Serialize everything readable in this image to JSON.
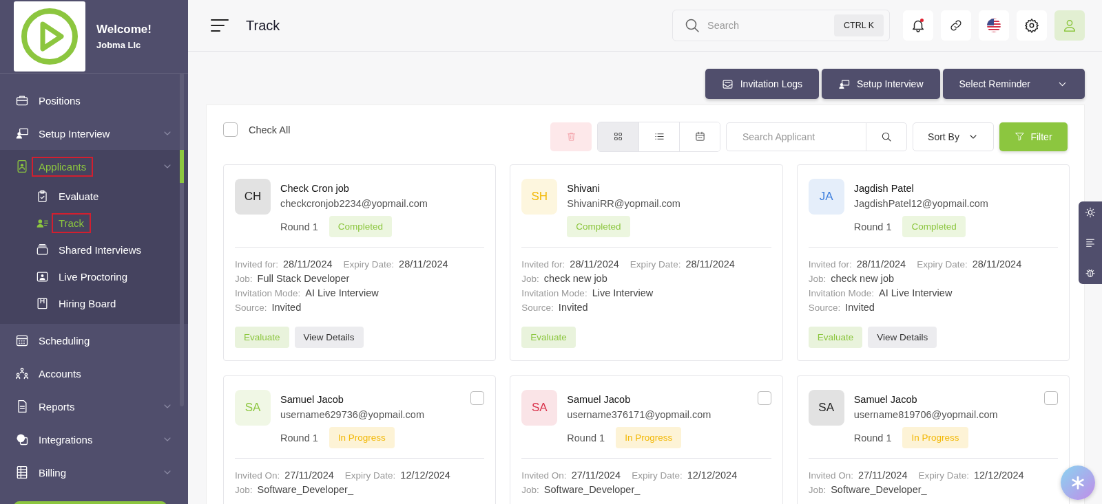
{
  "sidebar": {
    "greeting": "Welcome!",
    "company": "Jobma Llc",
    "items": [
      {
        "label": "Positions",
        "expandable": false,
        "expanded": false,
        "selected": false,
        "outlined": false
      },
      {
        "label": "Setup Interview",
        "expandable": true,
        "expanded": false,
        "selected": false,
        "outlined": false
      },
      {
        "label": "Applicants",
        "expandable": true,
        "expanded": true,
        "selected": true,
        "outlined": true,
        "children": [
          {
            "label": "Evaluate",
            "selected": false,
            "outlined": false
          },
          {
            "label": "Track",
            "selected": true,
            "outlined": true
          },
          {
            "label": "Shared Interviews",
            "selected": false,
            "outlined": false
          },
          {
            "label": "Live Proctoring",
            "selected": false,
            "outlined": false
          },
          {
            "label": "Hiring Board",
            "selected": false,
            "outlined": false
          }
        ]
      },
      {
        "label": "Scheduling",
        "expandable": false,
        "expanded": false,
        "selected": false,
        "outlined": false
      },
      {
        "label": "Accounts",
        "expandable": false,
        "expanded": false,
        "selected": false,
        "outlined": false
      },
      {
        "label": "Reports",
        "expandable": true,
        "expanded": false,
        "selected": false,
        "outlined": false
      },
      {
        "label": "Integrations",
        "expandable": true,
        "expanded": false,
        "selected": false,
        "outlined": false
      },
      {
        "label": "Billing",
        "expandable": true,
        "expanded": false,
        "selected": false,
        "outlined": false
      }
    ]
  },
  "header": {
    "title": "Track",
    "search": {
      "placeholder": "Search",
      "shortcut": "CTRL K"
    },
    "unread_notifications": true
  },
  "actions": [
    {
      "label": "Invitation Logs",
      "kind": "logs"
    },
    {
      "label": "Setup Interview",
      "kind": "setup"
    },
    {
      "label": "Select Reminder",
      "kind": "dropdown"
    }
  ],
  "toolbar": {
    "check_all": {
      "label": "Check All",
      "checked": false
    },
    "views": [
      {
        "selected": true
      },
      {
        "selected": false
      },
      {
        "selected": false
      }
    ],
    "search": {
      "placeholder": "Search Applicant"
    },
    "sort": {
      "label": "Sort By"
    },
    "filter": {
      "label": "Filter"
    }
  },
  "cards": [
    {
      "initials": "CH",
      "color": "#222222",
      "name": "Check Cron job",
      "email": "checkcronjob2234@yopmail.com",
      "round": "Round 1",
      "status": {
        "label": "Completed",
        "color": "#8cc63f"
      },
      "details": [
        [
          {
            "label": "Invited for:",
            "value": "28/11/2024"
          },
          {
            "label": "Expiry Date:",
            "value": "28/11/2024"
          }
        ],
        [
          {
            "label": "Job:",
            "value": "Full Stack Developer"
          }
        ],
        [
          {
            "label": "Invitation Mode:",
            "value": "AI Live Interview"
          }
        ],
        [
          {
            "label": "Source:",
            "value": "Invited"
          }
        ]
      ],
      "buttons": [
        {
          "label": "Evaluate",
          "kind": "evaluate"
        },
        {
          "label": "View Details",
          "kind": "details"
        }
      ]
    },
    {
      "initials": "SH",
      "color": "#f2b807",
      "name": "Shivani",
      "email": "ShivaniRR@yopmail.com",
      "status": {
        "label": "Completed",
        "color": "#8cc63f"
      },
      "details": [
        [
          {
            "label": "Invited for:",
            "value": "28/11/2024"
          },
          {
            "label": "Expiry Date:",
            "value": "28/11/2024"
          }
        ],
        [
          {
            "label": "Job:",
            "value": "check new job"
          }
        ],
        [
          {
            "label": "Invitation Mode:",
            "value": "Live Interview"
          }
        ],
        [
          {
            "label": "Source:",
            "value": "Invited"
          }
        ]
      ],
      "buttons": [
        {
          "label": "Evaluate",
          "kind": "evaluate"
        }
      ]
    },
    {
      "initials": "JA",
      "color": "#3b7ddd",
      "name": "Jagdish Patel",
      "email": "JagdishPatel12@yopmail.com",
      "round": "Round 1",
      "status": {
        "label": "Completed",
        "color": "#8cc63f"
      },
      "details": [
        [
          {
            "label": "Invited for:",
            "value": "28/11/2024"
          },
          {
            "label": "Expiry Date:",
            "value": "28/11/2024"
          }
        ],
        [
          {
            "label": "Job:",
            "value": "check new job"
          }
        ],
        [
          {
            "label": "Invitation Mode:",
            "value": "AI Live Interview"
          }
        ],
        [
          {
            "label": "Source:",
            "value": "Invited"
          }
        ]
      ],
      "buttons": [
        {
          "label": "Evaluate",
          "kind": "evaluate"
        },
        {
          "label": "View Details",
          "kind": "details"
        }
      ]
    },
    {
      "initials": "SA",
      "color": "#8cc63f",
      "name": "Samuel Jacob",
      "email": "username629736@yopmail.com",
      "round": "Round 1",
      "status": {
        "label": "In Progress",
        "color": "#f2b807"
      },
      "checked": false,
      "details": [
        [
          {
            "label": "Invited On:",
            "value": "27/11/2024"
          },
          {
            "label": "Expiry Date:",
            "value": "12/12/2024"
          }
        ],
        [
          {
            "label": "Job:",
            "value": "Software_Developer_"
          }
        ]
      ]
    },
    {
      "initials": "SA",
      "color": "#d9314a",
      "name": "Samuel Jacob",
      "email": "username376171@yopmail.com",
      "round": "Round 1",
      "status": {
        "label": "In Progress",
        "color": "#f2b807"
      },
      "checked": false,
      "details": [
        [
          {
            "label": "Invited On:",
            "value": "27/11/2024"
          },
          {
            "label": "Expiry Date:",
            "value": "12/12/2024"
          }
        ],
        [
          {
            "label": "Job:",
            "value": "Software_Developer_"
          }
        ]
      ]
    },
    {
      "initials": "SA",
      "color": "#222222",
      "name": "Samuel Jacob",
      "email": "username819706@yopmail.com",
      "round": "Round 1",
      "status": {
        "label": "In Progress",
        "color": "#f2b807"
      },
      "checked": false,
      "details": [
        [
          {
            "label": "Invited On:",
            "value": "27/11/2024"
          },
          {
            "label": "Expiry Date:",
            "value": "12/12/2024"
          }
        ],
        [
          {
            "label": "Job:",
            "value": "Software_Developer_"
          }
        ]
      ]
    }
  ]
}
